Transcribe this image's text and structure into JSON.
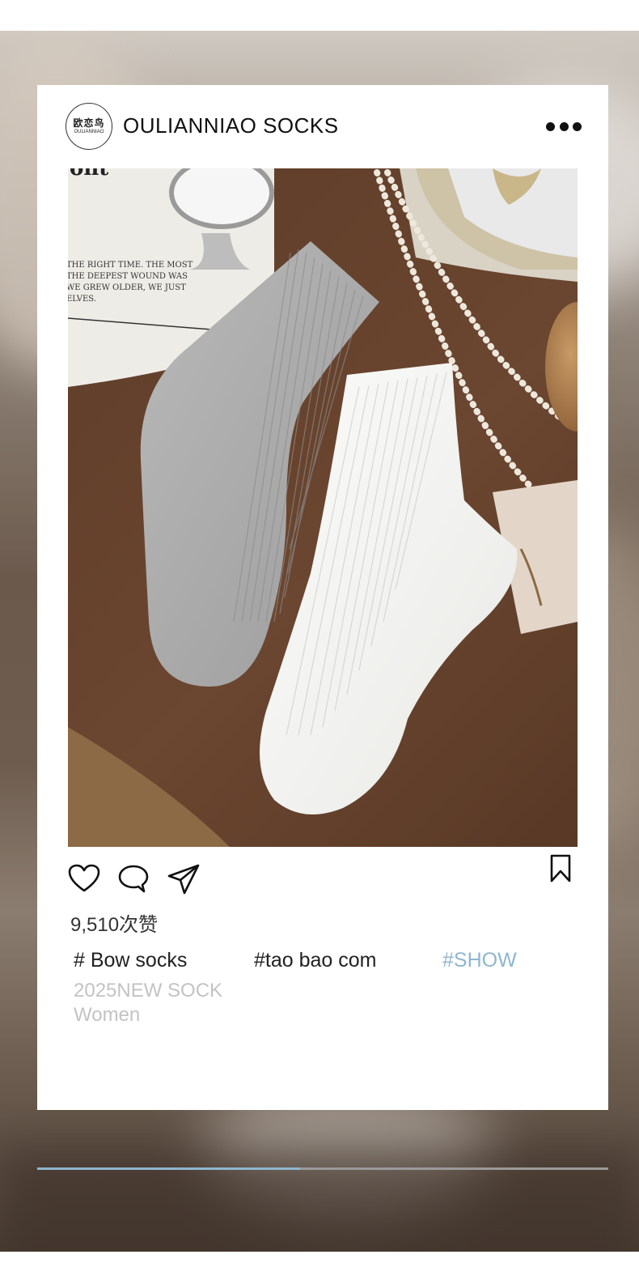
{
  "post": {
    "avatar_line1": "欧恋鸟",
    "avatar_line2": "OULIANNIAO",
    "account_name": "OULIANNIAO SOCKS",
    "photo_text": [
      "THE RIGHT TIME. THE MOST",
      "THE DEEPEST WOUND WAS",
      "WE GREW OLDER, WE JUST",
      "ELVES."
    ],
    "likes": "9,510次赞",
    "tags": [
      "# Bow socks",
      "#tao bao com",
      "#SHOW"
    ],
    "subtitle_line1": "2025NEW SOCK",
    "subtitle_line2": "Women"
  },
  "icons": {
    "menu": "more-dots-icon",
    "like": "heart-icon",
    "comment": "comment-bubble-icon",
    "share": "send-plane-icon",
    "save": "bookmark-icon"
  },
  "colors": {
    "accent_tag": "#8fb6cf",
    "progress": "#8fb6cf",
    "muted_text": "#c3c3c3"
  },
  "progress": {
    "fraction": 0.46
  }
}
